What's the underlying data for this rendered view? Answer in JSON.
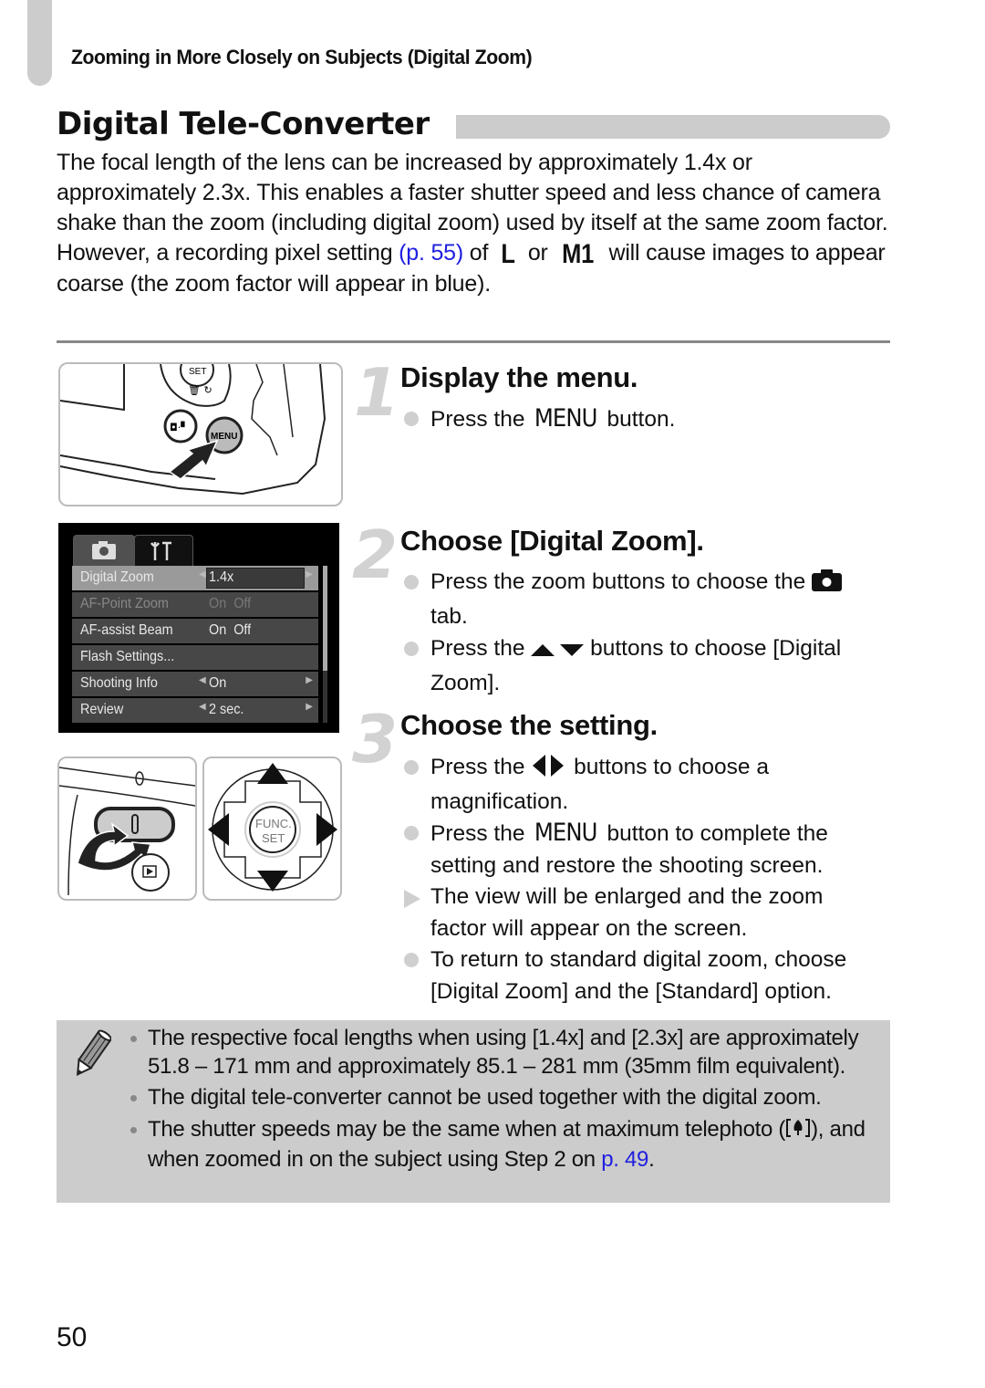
{
  "header": {
    "running_head": "Zooming in More Closely on Subjects (Digital Zoom)"
  },
  "section": {
    "title": "Digital Tele-Converter",
    "intro_p1": "The focal length of the lens can be increased by approximately 1.4x or approximately 2.3x. This enables a faster shutter speed and less chance of camera shake than the zoom (including digital zoom) used by itself at the same zoom factor.",
    "intro_p2_a": "However, a recording pixel setting ",
    "intro_p2_link": "(p. 55)",
    "intro_p2_b": " of ",
    "glyph_L": "L",
    "intro_p2_c": " or ",
    "glyph_M1": "M1",
    "intro_p2_d": " will cause images to appear coarse (the zoom factor will appear in blue)."
  },
  "colors": {
    "link": "#2020e0",
    "note_bg": "#cccccc",
    "accent_gray": "#cccccc"
  },
  "menu_screen": {
    "tabs": [
      {
        "icon": "camera-icon",
        "active": true
      },
      {
        "icon": "tools-icon",
        "active": false
      }
    ],
    "rows": [
      {
        "label": "Digital Zoom",
        "value": "1.4x",
        "selected": true,
        "arrows": true
      },
      {
        "label": "AF-Point Zoom",
        "value": "On  Off",
        "dim": true
      },
      {
        "label": "AF-assist Beam",
        "value": "On  Off"
      },
      {
        "label": "Flash Settings...",
        "value": ""
      },
      {
        "label": "Shooting Info",
        "value": "On",
        "arrows": true
      },
      {
        "label": "Review",
        "value": "2 sec.",
        "arrows": true
      }
    ]
  },
  "illustrations": {
    "camera_menu_button_label": "MENU",
    "camera_set_label": "SET",
    "dial_center_label_1": "FUNC.",
    "dial_center_label_2": "SET"
  },
  "steps": [
    {
      "number": "1",
      "title": "Display the menu.",
      "bullets": [
        {
          "type": "dot",
          "a": "Press the ",
          "key": "MENU",
          "b": " button."
        }
      ]
    },
    {
      "number": "2",
      "title": "Choose [Digital Zoom].",
      "bullets": [
        {
          "type": "dot",
          "a": "Press the zoom buttons to choose the ",
          "icon": "camera-icon",
          "b": " tab."
        },
        {
          "type": "dot",
          "a": "Press the ",
          "icon": "up-down-arrows-icon",
          "b": " buttons to choose [Digital Zoom]."
        }
      ]
    },
    {
      "number": "3",
      "title": "Choose the setting.",
      "bullets": [
        {
          "type": "dot",
          "a": "Press the ",
          "icon": "left-right-arrows-icon",
          "b": " buttons to choose a magnification."
        },
        {
          "type": "dot",
          "a": "Press the ",
          "key": "MENU",
          "b": " button to complete the setting and restore the shooting screen."
        },
        {
          "type": "result",
          "a": "The view will be enlarged and the zoom factor will appear on the screen."
        },
        {
          "type": "dot",
          "a": "To return to standard digital zoom, choose [Digital Zoom] and the [Standard] option."
        }
      ]
    }
  ],
  "note": {
    "items": [
      {
        "text": "The respective focal lengths when using [1.4x] and [2.3x] are approximately 51.8 – 171 mm and approximately 85.1 – 281 mm (35mm film equivalent)."
      },
      {
        "text": "The digital tele-converter cannot be used together with the digital zoom."
      },
      {
        "a": "The shutter speeds may be the same when at maximum telephoto (",
        "icon": "telephoto-icon",
        "b": "), and when zoomed in on the subject using Step 2 on ",
        "link": "p. 49",
        "c": "."
      }
    ]
  },
  "footer": {
    "page_number": "50"
  }
}
